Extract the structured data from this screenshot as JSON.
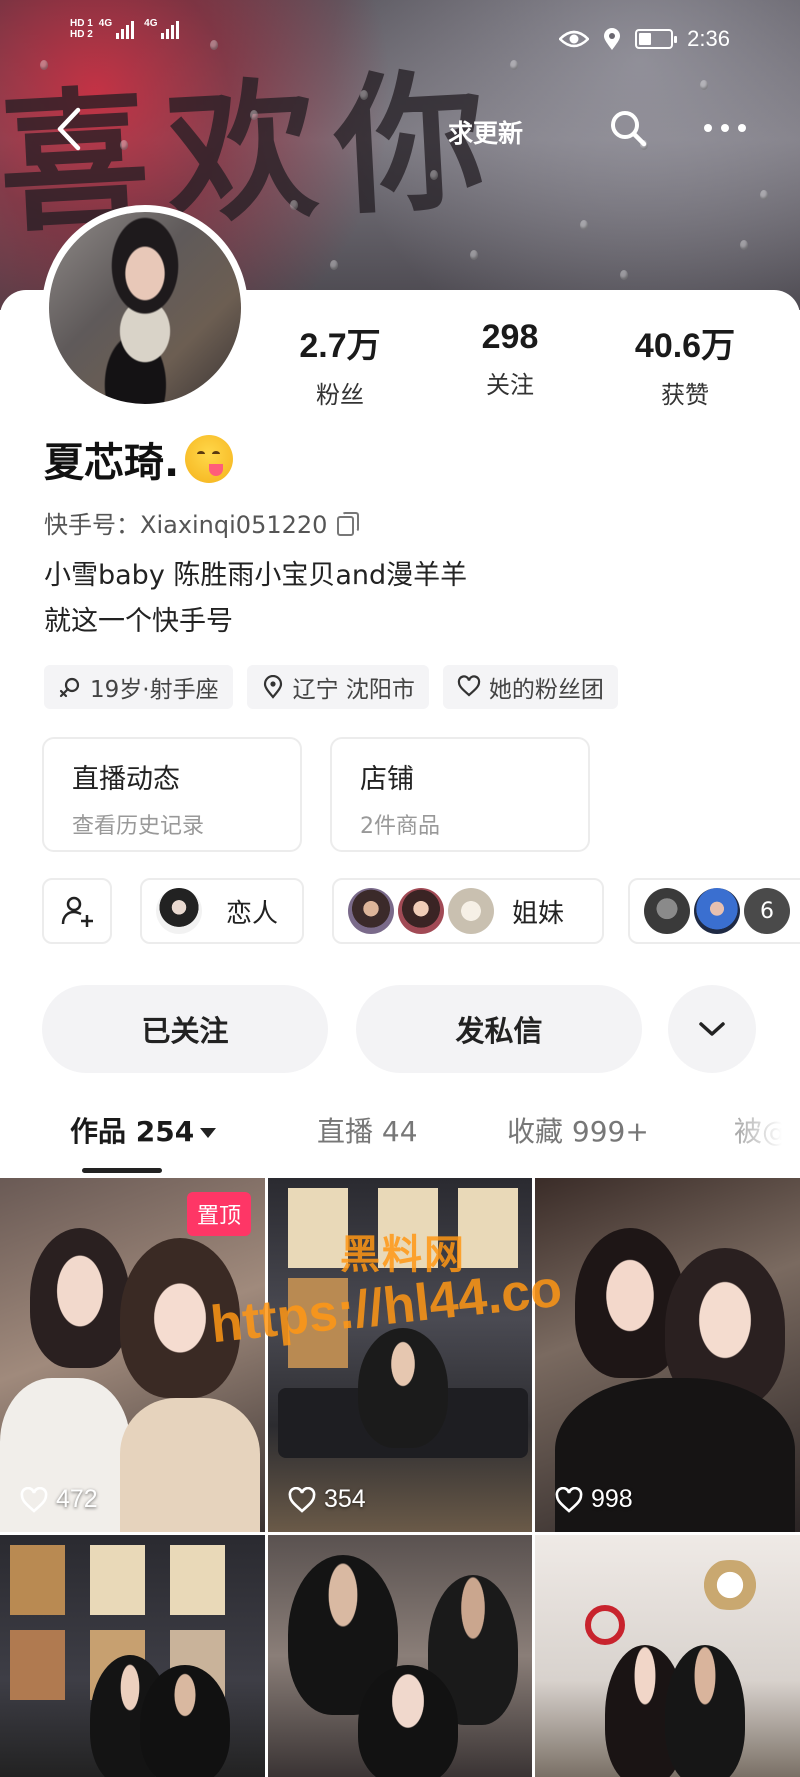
{
  "status_bar": {
    "sim1": "HD 1",
    "sim2": "HD 2",
    "network1": "4G",
    "network2": "4G",
    "time": "2:36"
  },
  "nav": {
    "title": "求更新",
    "back_icon": "chevron-left-icon",
    "search_icon": "search-icon",
    "more_icon": "more-dots-icon"
  },
  "cover": {
    "writing": "喜欢你"
  },
  "stats": [
    {
      "value": "2.7万",
      "label": "粉丝"
    },
    {
      "value": "298",
      "label": "关注"
    },
    {
      "value": "40.6万",
      "label": "获赞"
    }
  ],
  "profile": {
    "name": "夏芯琦.",
    "kuaishou_label": "快手号：Xiaxinqi051220",
    "bio_line1": "小雪baby 陈胜雨小宝贝and漫羊羊",
    "bio_line2": "就这一个快手号"
  },
  "tags": [
    {
      "icon": "female-icon",
      "text": "19岁·射手座"
    },
    {
      "icon": "location-icon",
      "text": "辽宁 沈阳市"
    },
    {
      "icon": "heart-icon",
      "text": "她的粉丝团"
    }
  ],
  "features": [
    {
      "title": "直播动态",
      "subtitle": "查看历史记录"
    },
    {
      "title": "店铺",
      "subtitle": "2件商品"
    }
  ],
  "relations": [
    {
      "label": "恋人"
    },
    {
      "label": "姐妹"
    },
    {
      "label": "6"
    }
  ],
  "actions": {
    "followed": "已关注",
    "message": "发私信"
  },
  "tabs": [
    {
      "label": "作品 254"
    },
    {
      "label": "直播 44"
    },
    {
      "label": "收藏 999+"
    },
    {
      "label": "被@"
    }
  ],
  "grid": [
    {
      "likes": "472",
      "pinned": "置顶"
    },
    {
      "likes": "354"
    },
    {
      "likes": "998"
    }
  ],
  "watermark": {
    "top": "黑料网",
    "bottom": "https://hl44.co"
  },
  "colors": {
    "accent": "#fe3666",
    "watermark": "#ff9614"
  }
}
